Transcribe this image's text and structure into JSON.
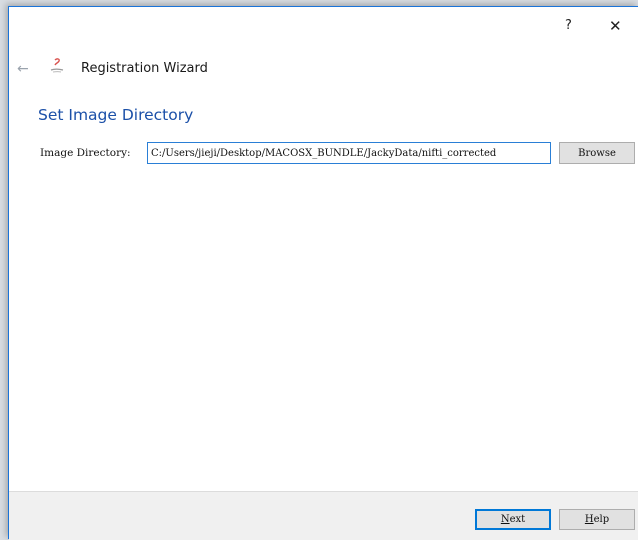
{
  "titlebar": {
    "help_label": "?",
    "close_label": "✕"
  },
  "header": {
    "back_icon": "back-arrow-icon",
    "app_icon": "registration-app-icon",
    "title": "Registration Wizard"
  },
  "page": {
    "title": "Set Image Directory",
    "field_label": "Image Directory:",
    "directory_value": "C:/Users/jieji/Desktop/MACOSX_BUNDLE/JackyData/nifti_corrected",
    "browse_label": "Browse"
  },
  "footer": {
    "next_label": "Next",
    "help_label": "Help"
  },
  "colors": {
    "accent": "#1b50a8",
    "focus_border": "#2a7fd6",
    "app_icon": "#d9534f"
  }
}
